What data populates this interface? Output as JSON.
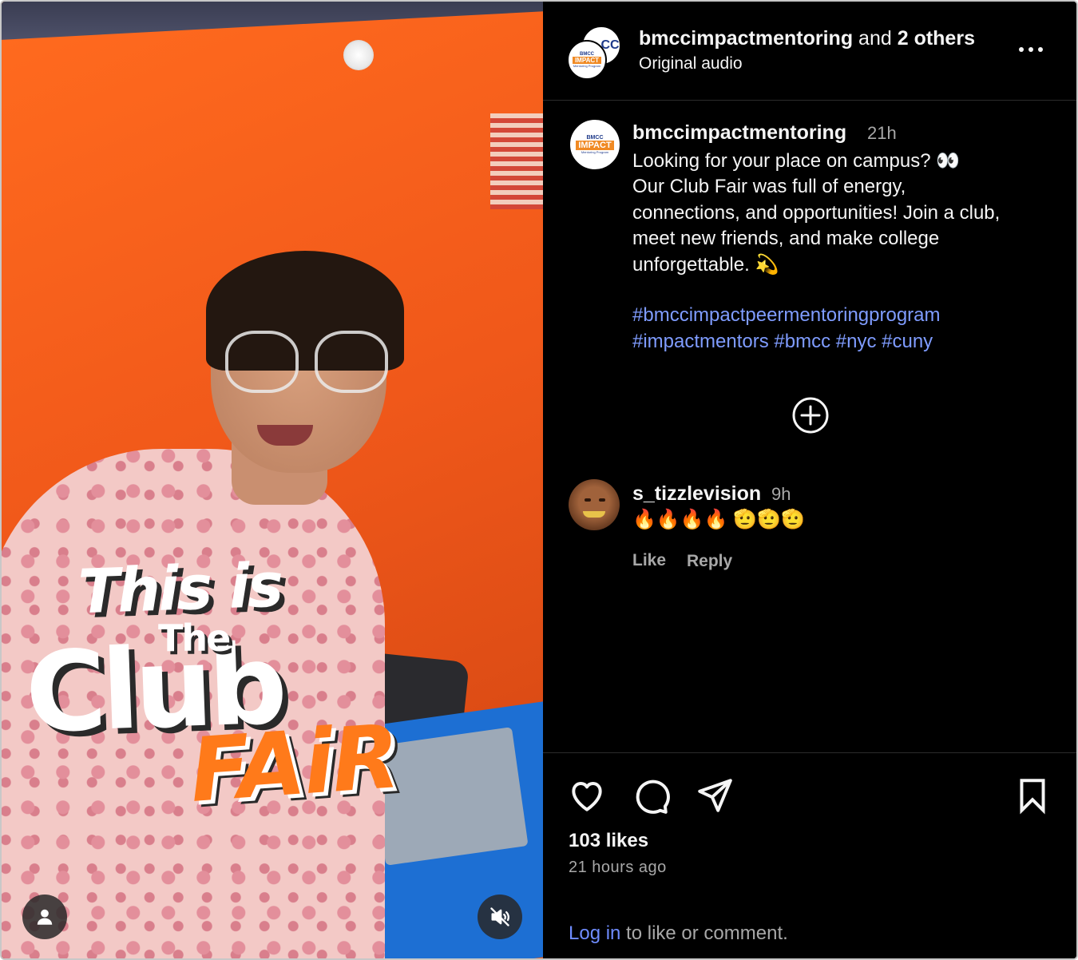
{
  "video": {
    "overlay": {
      "line1": "This is",
      "line2": "The",
      "line3": "Club",
      "line4": "FAiR"
    },
    "icons": [
      "user-icon",
      "volume-muted-icon"
    ]
  },
  "header": {
    "username": "bmccimpactmentoring",
    "joiner": " and ",
    "others": "2 others",
    "audio": "Original audio",
    "avatar_logo": {
      "top": "BMCC",
      "main": "IMPACT",
      "small": "Mentoring Program",
      "side": "CC"
    }
  },
  "caption": {
    "username": "bmccimpactmentoring",
    "time": "21h",
    "lines": [
      "Looking for your place on campus? 👀",
      "Our Club Fair was full of energy,",
      "connections, and opportunities! Join a club,",
      "meet new friends, and make college",
      "unforgettable. 💫"
    ],
    "hashtags": [
      "#bmccimpactpeermentoringprogram",
      "#impactmentors",
      "#bmcc",
      "#nyc",
      "#cuny"
    ]
  },
  "comment": {
    "username": "s_tizzlevision",
    "time": "9h",
    "text": "🔥🔥🔥🔥 🫡🫡🫡",
    "like_label": "Like",
    "reply_label": "Reply"
  },
  "actions": {
    "likes": "103 likes",
    "ago": "21 hours ago",
    "login_link": "Log in",
    "login_rest": " to like or comment."
  },
  "colors": {
    "panel_bg": "#000000",
    "text": "#f5f5f5",
    "muted": "#a8a8a8",
    "link": "#7f9cff",
    "video_orange": "#f0581a"
  }
}
